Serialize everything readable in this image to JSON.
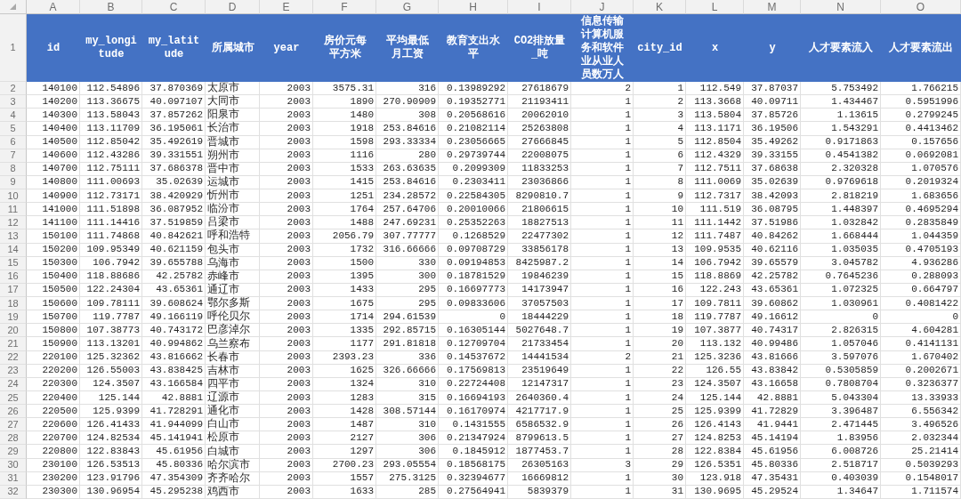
{
  "header_row_number": "1",
  "columns": [
    {
      "letter": "A",
      "header": "id",
      "kind": "number"
    },
    {
      "letter": "B",
      "header": "my_longitude",
      "kind": "number"
    },
    {
      "letter": "C",
      "header": "my_latitude",
      "kind": "number"
    },
    {
      "letter": "D",
      "header": "所属城市",
      "kind": "text"
    },
    {
      "letter": "E",
      "header": "year",
      "kind": "number"
    },
    {
      "letter": "F",
      "header": "房价元每平方米",
      "kind": "number"
    },
    {
      "letter": "G",
      "header": "平均最低月工资",
      "kind": "number"
    },
    {
      "letter": "H",
      "header": "教育支出水平",
      "kind": "number"
    },
    {
      "letter": "I",
      "header": "CO2排放量_吨",
      "kind": "number"
    },
    {
      "letter": "J",
      "header": "信息传输计算机服务和软件业从业人员数万人",
      "kind": "number"
    },
    {
      "letter": "K",
      "header": "city_id",
      "kind": "number"
    },
    {
      "letter": "L",
      "header": "x",
      "kind": "number"
    },
    {
      "letter": "M",
      "header": "y",
      "kind": "number"
    },
    {
      "letter": "N",
      "header": "人才要素流入",
      "kind": "number"
    },
    {
      "letter": "O",
      "header": "人才要素流出",
      "kind": "number"
    }
  ],
  "rows": [
    {
      "number": "2",
      "cells": [
        "140100",
        "112.54896",
        "37.870369",
        "太原市",
        "2003",
        "3575.31",
        "316",
        "0.13989292",
        "27618679",
        "2",
        "1",
        "112.549",
        "37.87037",
        "5.753492",
        "1.766215"
      ]
    },
    {
      "number": "3",
      "cells": [
        "140200",
        "113.36675",
        "40.097107",
        "大同市",
        "2003",
        "1890",
        "270.90909",
        "0.19352771",
        "21193411",
        "1",
        "2",
        "113.3668",
        "40.09711",
        "1.434467",
        "0.5951996"
      ]
    },
    {
      "number": "4",
      "cells": [
        "140300",
        "113.58043",
        "37.857262",
        "阳泉市",
        "2003",
        "1480",
        "308",
        "0.20568616",
        "20062010",
        "1",
        "3",
        "113.5804",
        "37.85726",
        "1.13615",
        "0.2799245"
      ]
    },
    {
      "number": "5",
      "cells": [
        "140400",
        "113.11709",
        "36.195061",
        "长治市",
        "2003",
        "1918",
        "253.84616",
        "0.21082114",
        "25263808",
        "1",
        "4",
        "113.1171",
        "36.19506",
        "1.543291",
        "0.4413462"
      ]
    },
    {
      "number": "6",
      "cells": [
        "140500",
        "112.85042",
        "35.492619",
        "晋城市",
        "2003",
        "1598",
        "293.33334",
        "0.23056665",
        "27666845",
        "1",
        "5",
        "112.8504",
        "35.49262",
        "0.9171863",
        "0.157656"
      ]
    },
    {
      "number": "7",
      "cells": [
        "140600",
        "112.43286",
        "39.331551",
        "朔州市",
        "2003",
        "1116",
        "280",
        "0.29739744",
        "22008075",
        "1",
        "6",
        "112.4329",
        "39.33155",
        "0.4541382",
        "0.0692081"
      ]
    },
    {
      "number": "8",
      "cells": [
        "140700",
        "112.75111",
        "37.686378",
        "晋中市",
        "2003",
        "1533",
        "263.63635",
        "0.2099309",
        "11833253",
        "1",
        "7",
        "112.7511",
        "37.68638",
        "2.320328",
        "1.070576"
      ]
    },
    {
      "number": "9",
      "cells": [
        "140800",
        "111.00693",
        "35.02639",
        "运城市",
        "2003",
        "1415",
        "253.84616",
        "0.2303411",
        "23036866",
        "1",
        "8",
        "111.0069",
        "35.02639",
        "0.9769618",
        "0.2019324"
      ]
    },
    {
      "number": "10",
      "cells": [
        "140900",
        "112.73171",
        "38.420929",
        "忻州市",
        "2003",
        "1251",
        "234.28572",
        "0.22584305",
        "8290810.7",
        "1",
        "9",
        "112.7317",
        "38.42093",
        "2.818219",
        "1.683656"
      ]
    },
    {
      "number": "11",
      "cells": [
        "141000",
        "111.51898",
        "36.087952",
        "临汾市",
        "2003",
        "1764",
        "257.64706",
        "0.20010066",
        "21806615",
        "1",
        "10",
        "111.519",
        "36.08795",
        "1.448397",
        "0.4695294"
      ]
    },
    {
      "number": "12",
      "cells": [
        "141100",
        "111.14416",
        "37.519859",
        "吕梁市",
        "2003",
        "1488",
        "247.69231",
        "0.25352263",
        "18827513",
        "1",
        "11",
        "111.1442",
        "37.51986",
        "1.032842",
        "0.2835849"
      ]
    },
    {
      "number": "13",
      "cells": [
        "150100",
        "111.74868",
        "40.842621",
        "呼和浩特",
        "2003",
        "2056.79",
        "307.77777",
        "0.1268529",
        "22477302",
        "1",
        "12",
        "111.7487",
        "40.84262",
        "1.668444",
        "1.044359"
      ]
    },
    {
      "number": "14",
      "cells": [
        "150200",
        "109.95349",
        "40.621159",
        "包头市",
        "2003",
        "1732",
        "316.66666",
        "0.09708729",
        "33856178",
        "1",
        "13",
        "109.9535",
        "40.62116",
        "1.035035",
        "0.4705193"
      ]
    },
    {
      "number": "15",
      "cells": [
        "150300",
        "106.7942",
        "39.655788",
        "乌海市",
        "2003",
        "1500",
        "330",
        "0.09194853",
        "8425987.2",
        "1",
        "14",
        "106.7942",
        "39.65579",
        "3.045782",
        "4.936286"
      ]
    },
    {
      "number": "16",
      "cells": [
        "150400",
        "118.88686",
        "42.25782",
        "赤峰市",
        "2003",
        "1395",
        "300",
        "0.18781529",
        "19846239",
        "1",
        "15",
        "118.8869",
        "42.25782",
        "0.7645236",
        "0.288093"
      ]
    },
    {
      "number": "17",
      "cells": [
        "150500",
        "122.24304",
        "43.65361",
        "通辽市",
        "2003",
        "1433",
        "295",
        "0.16697773",
        "14173947",
        "1",
        "16",
        "122.243",
        "43.65361",
        "1.072325",
        "0.664797"
      ]
    },
    {
      "number": "18",
      "cells": [
        "150600",
        "109.78111",
        "39.608624",
        "鄂尔多斯",
        "2003",
        "1675",
        "295",
        "0.09833606",
        "37057503",
        "1",
        "17",
        "109.7811",
        "39.60862",
        "1.030961",
        "0.4081422"
      ]
    },
    {
      "number": "19",
      "cells": [
        "150700",
        "119.7787",
        "49.166119",
        "呼伦贝尔",
        "2003",
        "1714",
        "294.61539",
        "0",
        "18444229",
        "1",
        "18",
        "119.7787",
        "49.16612",
        "0",
        "0"
      ]
    },
    {
      "number": "20",
      "cells": [
        "150800",
        "107.38773",
        "40.743172",
        "巴彦淖尔",
        "2003",
        "1335",
        "292.85715",
        "0.16305144",
        "5027648.7",
        "1",
        "19",
        "107.3877",
        "40.74317",
        "2.826315",
        "4.604281"
      ]
    },
    {
      "number": "21",
      "cells": [
        "150900",
        "113.13201",
        "40.994862",
        "乌兰察布",
        "2003",
        "1177",
        "291.81818",
        "0.12709704",
        "21733454",
        "1",
        "20",
        "113.132",
        "40.99486",
        "1.057046",
        "0.4141131"
      ]
    },
    {
      "number": "22",
      "cells": [
        "220100",
        "125.32362",
        "43.816662",
        "长春市",
        "2003",
        "2393.23",
        "336",
        "0.14537672",
        "14441534",
        "2",
        "21",
        "125.3236",
        "43.81666",
        "3.597076",
        "1.670402"
      ]
    },
    {
      "number": "23",
      "cells": [
        "220200",
        "126.55003",
        "43.838425",
        "吉林市",
        "2003",
        "1625",
        "326.66666",
        "0.17569813",
        "23519649",
        "1",
        "22",
        "126.55",
        "43.83842",
        "0.5305859",
        "0.2002671"
      ]
    },
    {
      "number": "24",
      "cells": [
        "220300",
        "124.3507",
        "43.166584",
        "四平市",
        "2003",
        "1324",
        "310",
        "0.22724408",
        "12147317",
        "1",
        "23",
        "124.3507",
        "43.16658",
        "0.7808704",
        "0.3236377"
      ]
    },
    {
      "number": "25",
      "cells": [
        "220400",
        "125.144",
        "42.8881",
        "辽源市",
        "2003",
        "1283",
        "315",
        "0.16694193",
        "2640360.4",
        "1",
        "24",
        "125.144",
        "42.8881",
        "5.043304",
        "13.33933"
      ]
    },
    {
      "number": "26",
      "cells": [
        "220500",
        "125.9399",
        "41.728291",
        "通化市",
        "2003",
        "1428",
        "308.57144",
        "0.16170974",
        "4217717.9",
        "1",
        "25",
        "125.9399",
        "41.72829",
        "3.396487",
        "6.556342"
      ]
    },
    {
      "number": "27",
      "cells": [
        "220600",
        "126.41433",
        "41.944099",
        "白山市",
        "2003",
        "1487",
        "310",
        "0.1431555",
        "6586532.9",
        "1",
        "26",
        "126.4143",
        "41.9441",
        "2.471445",
        "3.496526"
      ]
    },
    {
      "number": "28",
      "cells": [
        "220700",
        "124.82534",
        "45.141941",
        "松原市",
        "2003",
        "2127",
        "306",
        "0.21347924",
        "8799613.5",
        "1",
        "27",
        "124.8253",
        "45.14194",
        "1.83956",
        "2.032344"
      ]
    },
    {
      "number": "29",
      "cells": [
        "220800",
        "122.83843",
        "45.61956",
        "白城市",
        "2003",
        "1297",
        "306",
        "0.1845912",
        "1877453.7",
        "1",
        "28",
        "122.8384",
        "45.61956",
        "6.008726",
        "25.21414"
      ]
    },
    {
      "number": "30",
      "cells": [
        "230100",
        "126.53513",
        "45.80336",
        "哈尔滨市",
        "2003",
        "2700.23",
        "293.05554",
        "0.18568175",
        "26305163",
        "3",
        "29",
        "126.5351",
        "45.80336",
        "2.518717",
        "0.5039293"
      ]
    },
    {
      "number": "31",
      "cells": [
        "230200",
        "123.91796",
        "47.354309",
        "齐齐哈尔",
        "2003",
        "1557",
        "275.3125",
        "0.32394677",
        "16669812",
        "1",
        "30",
        "123.918",
        "47.35431",
        "0.403039",
        "0.1548017"
      ]
    },
    {
      "number": "32",
      "cells": [
        "230300",
        "130.96954",
        "45.295238",
        "鸡西市",
        "2003",
        "1633",
        "285",
        "0.27564941",
        "5839379",
        "1",
        "31",
        "130.9695",
        "45.29524",
        "1.34647",
        "1.711574"
      ]
    }
  ]
}
